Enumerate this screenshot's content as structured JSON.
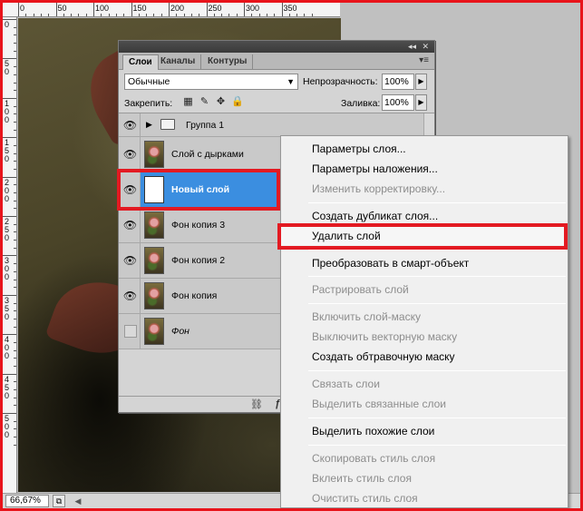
{
  "rulers": {
    "top": [
      "0",
      "50",
      "100",
      "150",
      "200",
      "250",
      "300",
      "350"
    ],
    "left": [
      "0",
      "5\n0",
      "1\n0\n0",
      "1\n5\n0",
      "2\n0\n0",
      "2\n5\n0",
      "3\n0\n0",
      "3\n5\n0",
      "4\n0\n0",
      "4\n5\n0",
      "5\n0\n0"
    ]
  },
  "panel": {
    "tabs": [
      "Слои",
      "Каналы",
      "Контуры"
    ],
    "blend_mode": "Обычные",
    "opacity_label": "Непрозрачность:",
    "opacity_value": "100%",
    "lock_label": "Закрепить:",
    "fill_label": "Заливка:",
    "fill_value": "100%",
    "layers": [
      {
        "name": "Группа 1",
        "type": "group",
        "visible": true
      },
      {
        "name": "Слой с дырками",
        "type": "layer",
        "visible": true
      },
      {
        "name": "Новый слой",
        "type": "white",
        "visible": true,
        "selected": true
      },
      {
        "name": "Фон копия 3",
        "type": "layer",
        "visible": true
      },
      {
        "name": "Фон копия 2",
        "type": "layer",
        "visible": true
      },
      {
        "name": "Фон копия",
        "type": "layer",
        "visible": true
      },
      {
        "name": "Фон",
        "type": "layer",
        "visible": false,
        "italic": true
      }
    ]
  },
  "status": {
    "zoom": "66,67%"
  },
  "context_menu": {
    "items": [
      {
        "label": "Параметры слоя...",
        "disabled": false
      },
      {
        "label": "Параметры наложения...",
        "disabled": false
      },
      {
        "label": "Изменить корректировку...",
        "disabled": true
      },
      {
        "sep": true
      },
      {
        "label": "Создать дубликат слоя...",
        "disabled": false
      },
      {
        "label": "Удалить слой",
        "disabled": false,
        "hover": true
      },
      {
        "sep": true
      },
      {
        "label": "Преобразовать в смарт-объект",
        "disabled": false
      },
      {
        "sep": true
      },
      {
        "label": "Растрировать слой",
        "disabled": true
      },
      {
        "sep": true
      },
      {
        "label": "Включить слой-маску",
        "disabled": true
      },
      {
        "label": "Выключить векторную маску",
        "disabled": true
      },
      {
        "label": "Создать обтравочную маску",
        "disabled": false
      },
      {
        "sep": true
      },
      {
        "label": "Связать слои",
        "disabled": true
      },
      {
        "label": "Выделить связанные слои",
        "disabled": true
      },
      {
        "sep": true
      },
      {
        "label": "Выделить похожие слои",
        "disabled": false
      },
      {
        "sep": true
      },
      {
        "label": "Скопировать стиль слоя",
        "disabled": true
      },
      {
        "label": "Вклеить стиль слоя",
        "disabled": true
      },
      {
        "label": "Очистить стиль слоя",
        "disabled": true
      }
    ]
  },
  "colors": {
    "highlight": "#e31a22",
    "selection": "#3b8ee0"
  }
}
